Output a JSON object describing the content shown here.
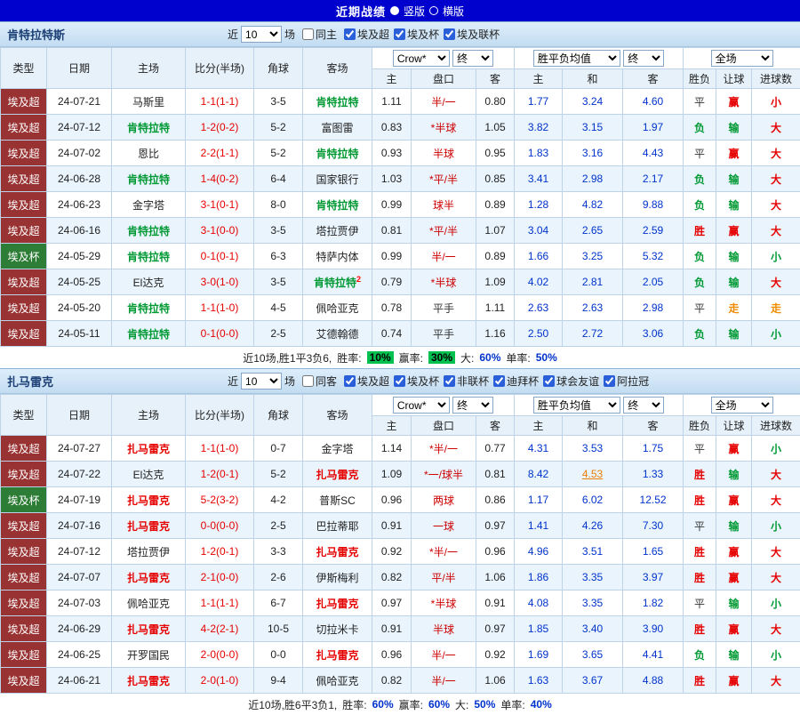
{
  "topbar": {
    "title": "近期战绩",
    "vertical_label": "竖版",
    "horizontal_label": "横版"
  },
  "colors": {
    "topbar_bg": "#0101cd",
    "win": "#e60000",
    "loss": "#009933",
    "draw": "#333333",
    "push": "#f08c00",
    "focal_green": "#009933",
    "focal_red": "#e60000",
    "score": "#e60000",
    "avg": "#0033cc",
    "handicap": "#cc0000",
    "league_super_bg": "#993333",
    "league_cup_bg": "#2e7d36",
    "highlight_bg": "#00c050"
  },
  "sections": [
    {
      "team": "肯特拉特斯",
      "focal_class": "focal-green",
      "near_label": "近",
      "near_count": "10",
      "matches_label": "场",
      "same_checkbox": "同主",
      "leagues": [
        "埃及超",
        "埃及杯",
        "埃及联杯"
      ],
      "selects": {
        "bookmaker": "Crow*",
        "odds_stage": "终",
        "avg": "胜平负均值",
        "avg_stage": "终",
        "scope": "全场"
      },
      "columns": [
        "类型",
        "日期",
        "主场",
        "比分(半场)",
        "角球",
        "客场",
        "主",
        "盘口",
        "客",
        "主",
        "和",
        "客",
        "胜负",
        "让球",
        "进球数"
      ],
      "rows": [
        [
          "埃及超",
          "24-07-21",
          "马斯里",
          "1-1(1-1)",
          "3-5",
          "肯特拉特",
          "1.11",
          "半/一",
          "0.80",
          "1.77",
          "3.24",
          "4.60",
          "平",
          "赢",
          "小"
        ],
        [
          "埃及超",
          "24-07-12",
          "肯特拉特",
          "1-2(0-2)",
          "5-2",
          "富图雷",
          "0.83",
          "*半球",
          "1.05",
          "3.82",
          "3.15",
          "1.97",
          "负",
          "输",
          "大"
        ],
        [
          "埃及超",
          "24-07-02",
          "恩比",
          "2-2(1-1)",
          "5-2",
          "肯特拉特",
          "0.93",
          "半球",
          "0.95",
          "1.83",
          "3.16",
          "4.43",
          "平",
          "赢",
          "大"
        ],
        [
          "埃及超",
          "24-06-28",
          "肯特拉特",
          "1-4(0-2)",
          "6-4",
          "国家银行",
          "1.03",
          "*平/半",
          "0.85",
          "3.41",
          "2.98",
          "2.17",
          "负",
          "输",
          "大"
        ],
        [
          "埃及超",
          "24-06-23",
          "金字塔",
          "3-1(0-1)",
          "8-0",
          "肯特拉特",
          "0.99",
          "球半",
          "0.89",
          "1.28",
          "4.82",
          "9.88",
          "负",
          "输",
          "大"
        ],
        [
          "埃及超",
          "24-06-16",
          "肯特拉特",
          "3-1(0-0)",
          "3-5",
          "塔拉贾伊",
          "0.81",
          "*平/半",
          "1.07",
          "3.04",
          "2.65",
          "2.59",
          "胜",
          "赢",
          "大"
        ],
        [
          "埃及杯",
          "24-05-29",
          "肯特拉特",
          "0-1(0-1)",
          "6-3",
          "特萨内体",
          "0.99",
          "半/一",
          "0.89",
          "1.66",
          "3.25",
          "5.32",
          "负",
          "输",
          "小"
        ],
        [
          "埃及超",
          "24-05-25",
          "El达克",
          "3-0(1-0)",
          "3-5",
          "肯特拉特",
          "0.79",
          "*半球",
          "1.09",
          "4.02",
          "2.81",
          "2.05",
          "负",
          "输",
          "大"
        ],
        [
          "埃及超",
          "24-05-20",
          "肯特拉特",
          "1-1(1-0)",
          "4-5",
          "佩哈亚克",
          "0.78",
          "平手",
          "1.11",
          "2.63",
          "2.63",
          "2.98",
          "平",
          "走",
          "走"
        ],
        [
          "埃及超",
          "24-05-11",
          "肯特拉特",
          "0-1(0-0)",
          "2-5",
          "艾德翰德",
          "0.74",
          "平手",
          "1.16",
          "2.50",
          "2.72",
          "3.06",
          "负",
          "输",
          "小"
        ]
      ],
      "row_meta": [
        {
          "focal": "away",
          "goals_red": true
        },
        {
          "focal": "home"
        },
        {
          "focal": "away"
        },
        {
          "focal": "home"
        },
        {
          "focal": "away"
        },
        {
          "focal": "home"
        },
        {
          "focal": "home"
        },
        {
          "focal": "away",
          "away_sup": "2"
        },
        {
          "focal": "home"
        },
        {
          "focal": "home"
        }
      ],
      "footer_parts": [
        {
          "text": "近10场,胜1平3负6,",
          "cls": "plain"
        },
        {
          "text": "胜率:",
          "cls": "plain"
        },
        {
          "text": "10%",
          "cls": "hl"
        },
        {
          "text": "赢率:",
          "cls": "plain"
        },
        {
          "text": "30%",
          "cls": "hl"
        },
        {
          "text": "大:",
          "cls": "plain"
        },
        {
          "text": "60%",
          "cls": "blue"
        },
        {
          "text": "单率:",
          "cls": "plain"
        },
        {
          "text": "50%",
          "cls": "blue"
        }
      ]
    },
    {
      "team": "扎马雷克",
      "focal_class": "focal-red",
      "near_label": "近",
      "near_count": "10",
      "matches_label": "场",
      "same_checkbox": "同客",
      "leagues": [
        "埃及超",
        "埃及杯",
        "非联杯",
        "迪拜杯",
        "球会友谊",
        "阿拉冠"
      ],
      "selects": {
        "bookmaker": "Crow*",
        "odds_stage": "终",
        "avg": "胜平负均值",
        "avg_stage": "终",
        "scope": "全场"
      },
      "columns": [
        "类型",
        "日期",
        "主场",
        "比分(半场)",
        "角球",
        "客场",
        "主",
        "盘口",
        "客",
        "主",
        "和",
        "客",
        "胜负",
        "让球",
        "进球数"
      ],
      "rows": [
        [
          "埃及超",
          "24-07-27",
          "扎马雷克",
          "1-1(1-0)",
          "0-7",
          "金字塔",
          "1.14",
          "*半/一",
          "0.77",
          "4.31",
          "3.53",
          "1.75",
          "平",
          "赢",
          "小"
        ],
        [
          "埃及超",
          "24-07-22",
          "El达克",
          "1-2(0-1)",
          "5-2",
          "扎马雷克",
          "1.09",
          "*一/球半",
          "0.81",
          "8.42",
          "4.53",
          "1.33",
          "胜",
          "输",
          "大"
        ],
        [
          "埃及杯",
          "24-07-19",
          "扎马雷克",
          "5-2(3-2)",
          "4-2",
          "普斯SC",
          "0.96",
          "两球",
          "0.86",
          "1.17",
          "6.02",
          "12.52",
          "胜",
          "赢",
          "大"
        ],
        [
          "埃及超",
          "24-07-16",
          "扎马雷克",
          "0-0(0-0)",
          "2-5",
          "巴拉蒂耶",
          "0.91",
          "一球",
          "0.97",
          "1.41",
          "4.26",
          "7.30",
          "平",
          "输",
          "小"
        ],
        [
          "埃及超",
          "24-07-12",
          "塔拉贾伊",
          "1-2(0-1)",
          "3-3",
          "扎马雷克",
          "0.92",
          "*半/一",
          "0.96",
          "4.96",
          "3.51",
          "1.65",
          "胜",
          "赢",
          "大"
        ],
        [
          "埃及超",
          "24-07-07",
          "扎马雷克",
          "2-1(0-0)",
          "2-6",
          "伊斯梅利",
          "0.82",
          "平/半",
          "1.06",
          "1.86",
          "3.35",
          "3.97",
          "胜",
          "赢",
          "大"
        ],
        [
          "埃及超",
          "24-07-03",
          "佩哈亚克",
          "1-1(1-1)",
          "6-7",
          "扎马雷克",
          "0.97",
          "*半球",
          "0.91",
          "4.08",
          "3.35",
          "1.82",
          "平",
          "输",
          "小"
        ],
        [
          "埃及超",
          "24-06-29",
          "扎马雷克",
          "4-2(2-1)",
          "10-5",
          "切拉米卡",
          "0.91",
          "半球",
          "0.97",
          "1.85",
          "3.40",
          "3.90",
          "胜",
          "赢",
          "大"
        ],
        [
          "埃及超",
          "24-06-25",
          "开罗国民",
          "2-0(0-0)",
          "0-0",
          "扎马雷克",
          "0.96",
          "半/一",
          "0.92",
          "1.69",
          "3.65",
          "4.41",
          "负",
          "输",
          "小"
        ],
        [
          "埃及超",
          "24-06-21",
          "扎马雷克",
          "2-0(1-0)",
          "9-4",
          "佩哈亚克",
          "0.82",
          "半/一",
          "1.06",
          "1.63",
          "3.67",
          "4.88",
          "胜",
          "赢",
          "大"
        ]
      ],
      "row_meta": [
        {
          "focal": "home"
        },
        {
          "focal": "away",
          "avg_alert": true
        },
        {
          "focal": "home"
        },
        {
          "focal": "home"
        },
        {
          "focal": "away"
        },
        {
          "focal": "home"
        },
        {
          "focal": "away"
        },
        {
          "focal": "home"
        },
        {
          "focal": "away"
        },
        {
          "focal": "home"
        }
      ],
      "footer_parts": [
        {
          "text": "近10场,胜6平3负1,",
          "cls": "plain"
        },
        {
          "text": "胜率:",
          "cls": "plain"
        },
        {
          "text": "60%",
          "cls": "blue"
        },
        {
          "text": "赢率:",
          "cls": "plain"
        },
        {
          "text": "60%",
          "cls": "blue"
        },
        {
          "text": "大:",
          "cls": "plain"
        },
        {
          "text": "50%",
          "cls": "blue"
        },
        {
          "text": "单率:",
          "cls": "plain"
        },
        {
          "text": "40%",
          "cls": "blue"
        }
      ]
    }
  ]
}
